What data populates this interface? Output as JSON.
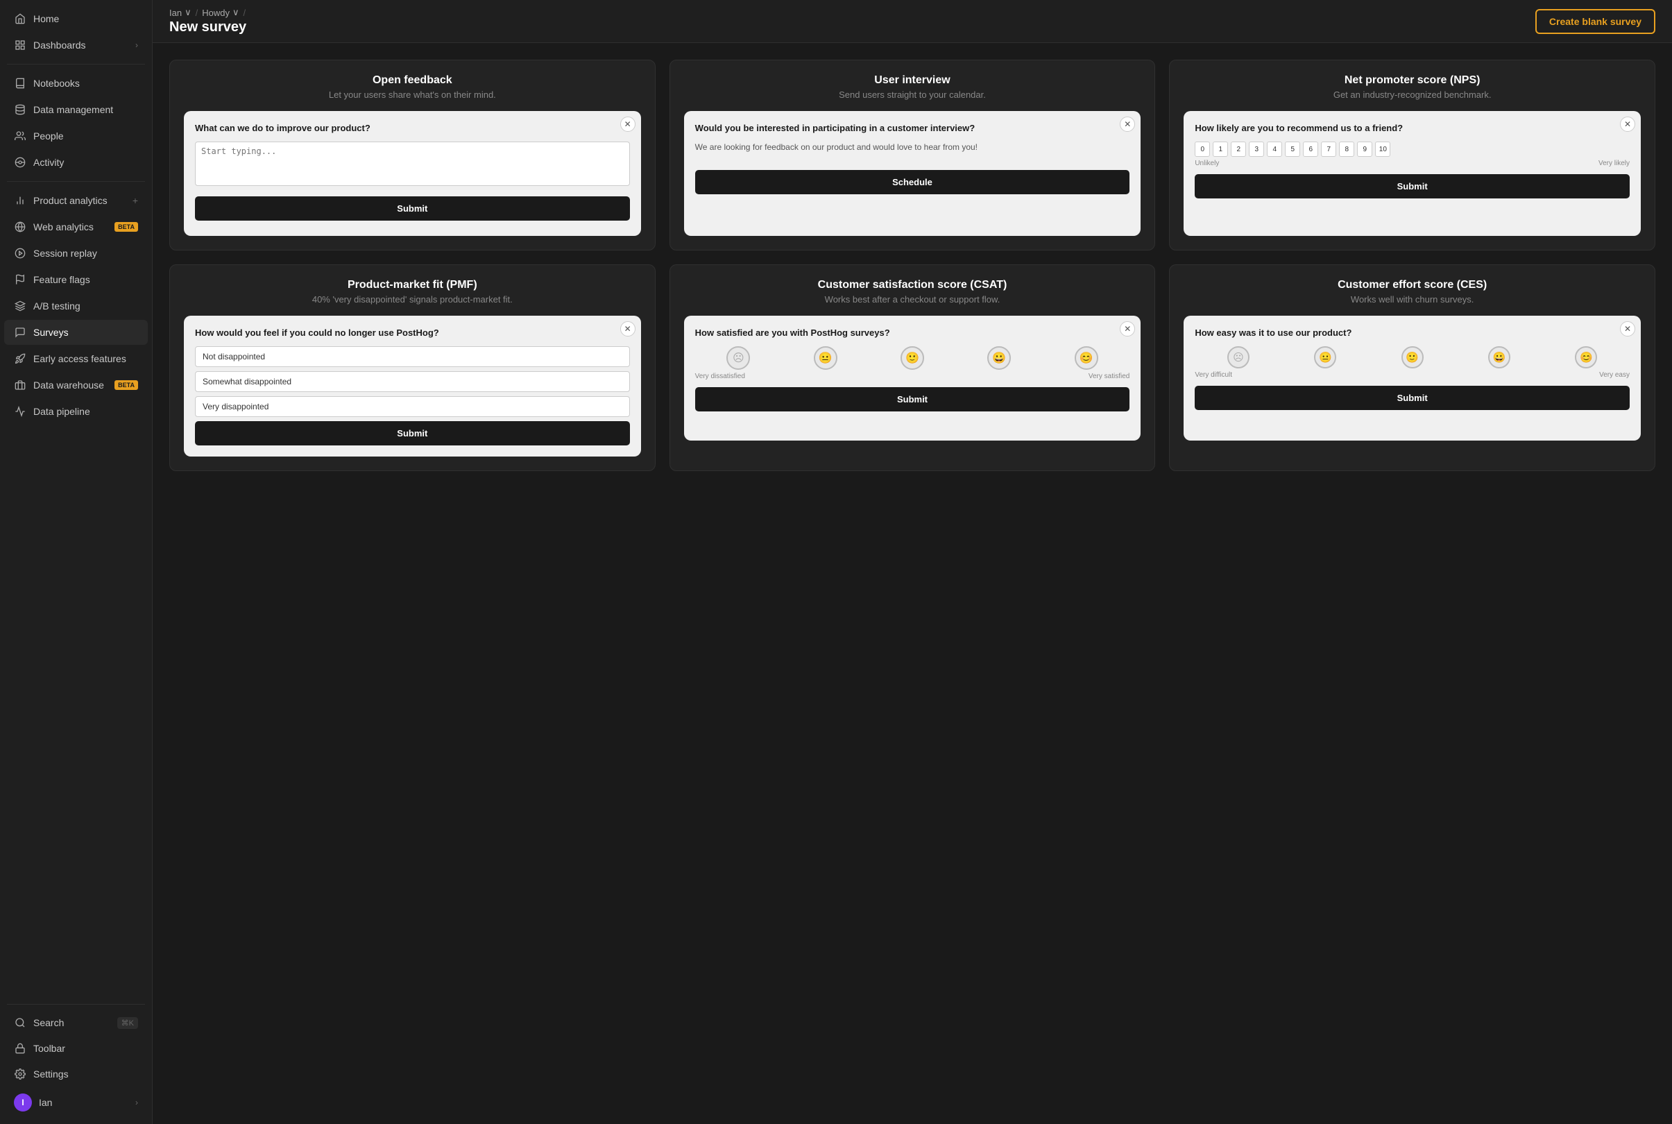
{
  "sidebar": {
    "items": [
      {
        "id": "home",
        "label": "Home",
        "icon": "home"
      },
      {
        "id": "dashboards",
        "label": "Dashboards",
        "icon": "dashboard",
        "hasChevron": true,
        "hasSeparator": true
      },
      {
        "id": "notebooks",
        "label": "Notebooks",
        "icon": "notebook"
      },
      {
        "id": "data-management",
        "label": "Data management",
        "icon": "data-management"
      },
      {
        "id": "people",
        "label": "People",
        "icon": "people"
      },
      {
        "id": "activity",
        "label": "Activity",
        "icon": "activity"
      },
      {
        "id": "product-analytics",
        "label": "Product analytics",
        "icon": "chart",
        "hasPlus": true
      },
      {
        "id": "web-analytics",
        "label": "Web analytics",
        "icon": "web",
        "badge": "BETA"
      },
      {
        "id": "session-replay",
        "label": "Session replay",
        "icon": "replay"
      },
      {
        "id": "feature-flags",
        "label": "Feature flags",
        "icon": "flag"
      },
      {
        "id": "ab-testing",
        "label": "A/B testing",
        "icon": "ab"
      },
      {
        "id": "surveys",
        "label": "Surveys",
        "icon": "survey",
        "active": true
      },
      {
        "id": "early-access",
        "label": "Early access features",
        "icon": "rocket"
      },
      {
        "id": "data-warehouse",
        "label": "Data warehouse",
        "icon": "warehouse",
        "badge": "BETA"
      },
      {
        "id": "data-pipeline",
        "label": "Data pipeline",
        "icon": "pipeline"
      }
    ],
    "bottom": [
      {
        "id": "search",
        "label": "Search",
        "icon": "search",
        "shortcut": "⌘K"
      },
      {
        "id": "toolbar",
        "label": "Toolbar",
        "icon": "toolbar"
      },
      {
        "id": "settings",
        "label": "Settings",
        "icon": "settings"
      }
    ],
    "user": {
      "label": "Ian",
      "initial": "I"
    }
  },
  "topbar": {
    "breadcrumb": [
      {
        "label": "Ian",
        "hasChevron": true
      },
      {
        "label": "Howdy",
        "hasChevron": true
      },
      {
        "label": ""
      }
    ],
    "title": "New survey",
    "create_button": "Create blank survey"
  },
  "survey_cards": [
    {
      "id": "open-feedback",
      "title": "Open feedback",
      "subtitle": "Let your users share what's on their mind.",
      "type": "open",
      "widget": {
        "question": "What can we do to improve our product?",
        "placeholder": "Start typing...",
        "submit": "Submit"
      }
    },
    {
      "id": "user-interview",
      "title": "User interview",
      "subtitle": "Send users straight to your calendar.",
      "type": "interview",
      "widget": {
        "question": "Would you be interested in participating in a customer interview?",
        "desc": "We are looking for feedback on our product and would love to hear from you!",
        "schedule": "Schedule"
      }
    },
    {
      "id": "nps",
      "title": "Net promoter score (NPS)",
      "subtitle": "Get an industry-recognized benchmark.",
      "type": "nps",
      "widget": {
        "question": "How likely are you to recommend us to a friend?",
        "scale": [
          "0",
          "1",
          "2",
          "3",
          "4",
          "5",
          "6",
          "7",
          "8",
          "9",
          "10"
        ],
        "label_low": "Unlikely",
        "label_high": "Very likely",
        "submit": "Submit"
      }
    },
    {
      "id": "pmf",
      "title": "Product-market fit (PMF)",
      "subtitle": "40% 'very disappointed' signals product-market fit.",
      "type": "pmf",
      "widget": {
        "question": "How would you feel if you could no longer use PostHog?",
        "options": [
          "Not disappointed",
          "Somewhat disappointed",
          "Very disappointed"
        ],
        "submit": "Submit"
      }
    },
    {
      "id": "csat",
      "title": "Customer satisfaction score (CSAT)",
      "subtitle": "Works best after a checkout or support flow.",
      "type": "csat",
      "widget": {
        "question": "How satisfied are you with PostHog surveys?",
        "label_low": "Very dissatisfied",
        "label_high": "Very satisfied",
        "submit": "Submit"
      }
    },
    {
      "id": "ces",
      "title": "Customer effort score (CES)",
      "subtitle": "Works well with churn surveys.",
      "type": "ces",
      "widget": {
        "question": "How easy was it to use our product?",
        "label_low": "Very difficult",
        "label_high": "Very easy",
        "submit": "Submit"
      }
    }
  ]
}
